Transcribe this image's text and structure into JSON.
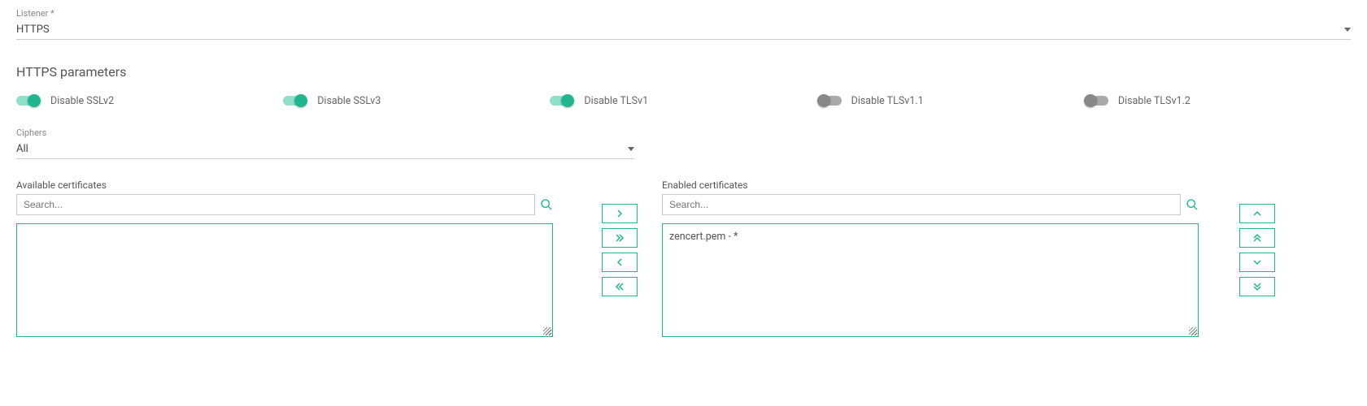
{
  "listener": {
    "label": "Listener *",
    "value": "HTTPS"
  },
  "section_title": "HTTPS parameters",
  "toggles": [
    {
      "label": "Disable SSLv2",
      "on": true
    },
    {
      "label": "Disable SSLv3",
      "on": true
    },
    {
      "label": "Disable TLSv1",
      "on": true
    },
    {
      "label": "Disable TLSv1.1",
      "on": false
    },
    {
      "label": "Disable TLSv1.2",
      "on": false
    }
  ],
  "ciphers": {
    "label": "Ciphers",
    "value": "All"
  },
  "available": {
    "label": "Available certificates",
    "search_placeholder": "Search...",
    "items": []
  },
  "enabled": {
    "label": "Enabled certificates",
    "search_placeholder": "Search...",
    "items": [
      "zencert.pem - *"
    ]
  },
  "icons": {
    "right": "›",
    "right_all": "»",
    "left": "‹",
    "left_all": "«",
    "up": "ˆ",
    "up_all": "ˆˆ",
    "down": "ˇ",
    "down_all": "ˇˇ"
  }
}
